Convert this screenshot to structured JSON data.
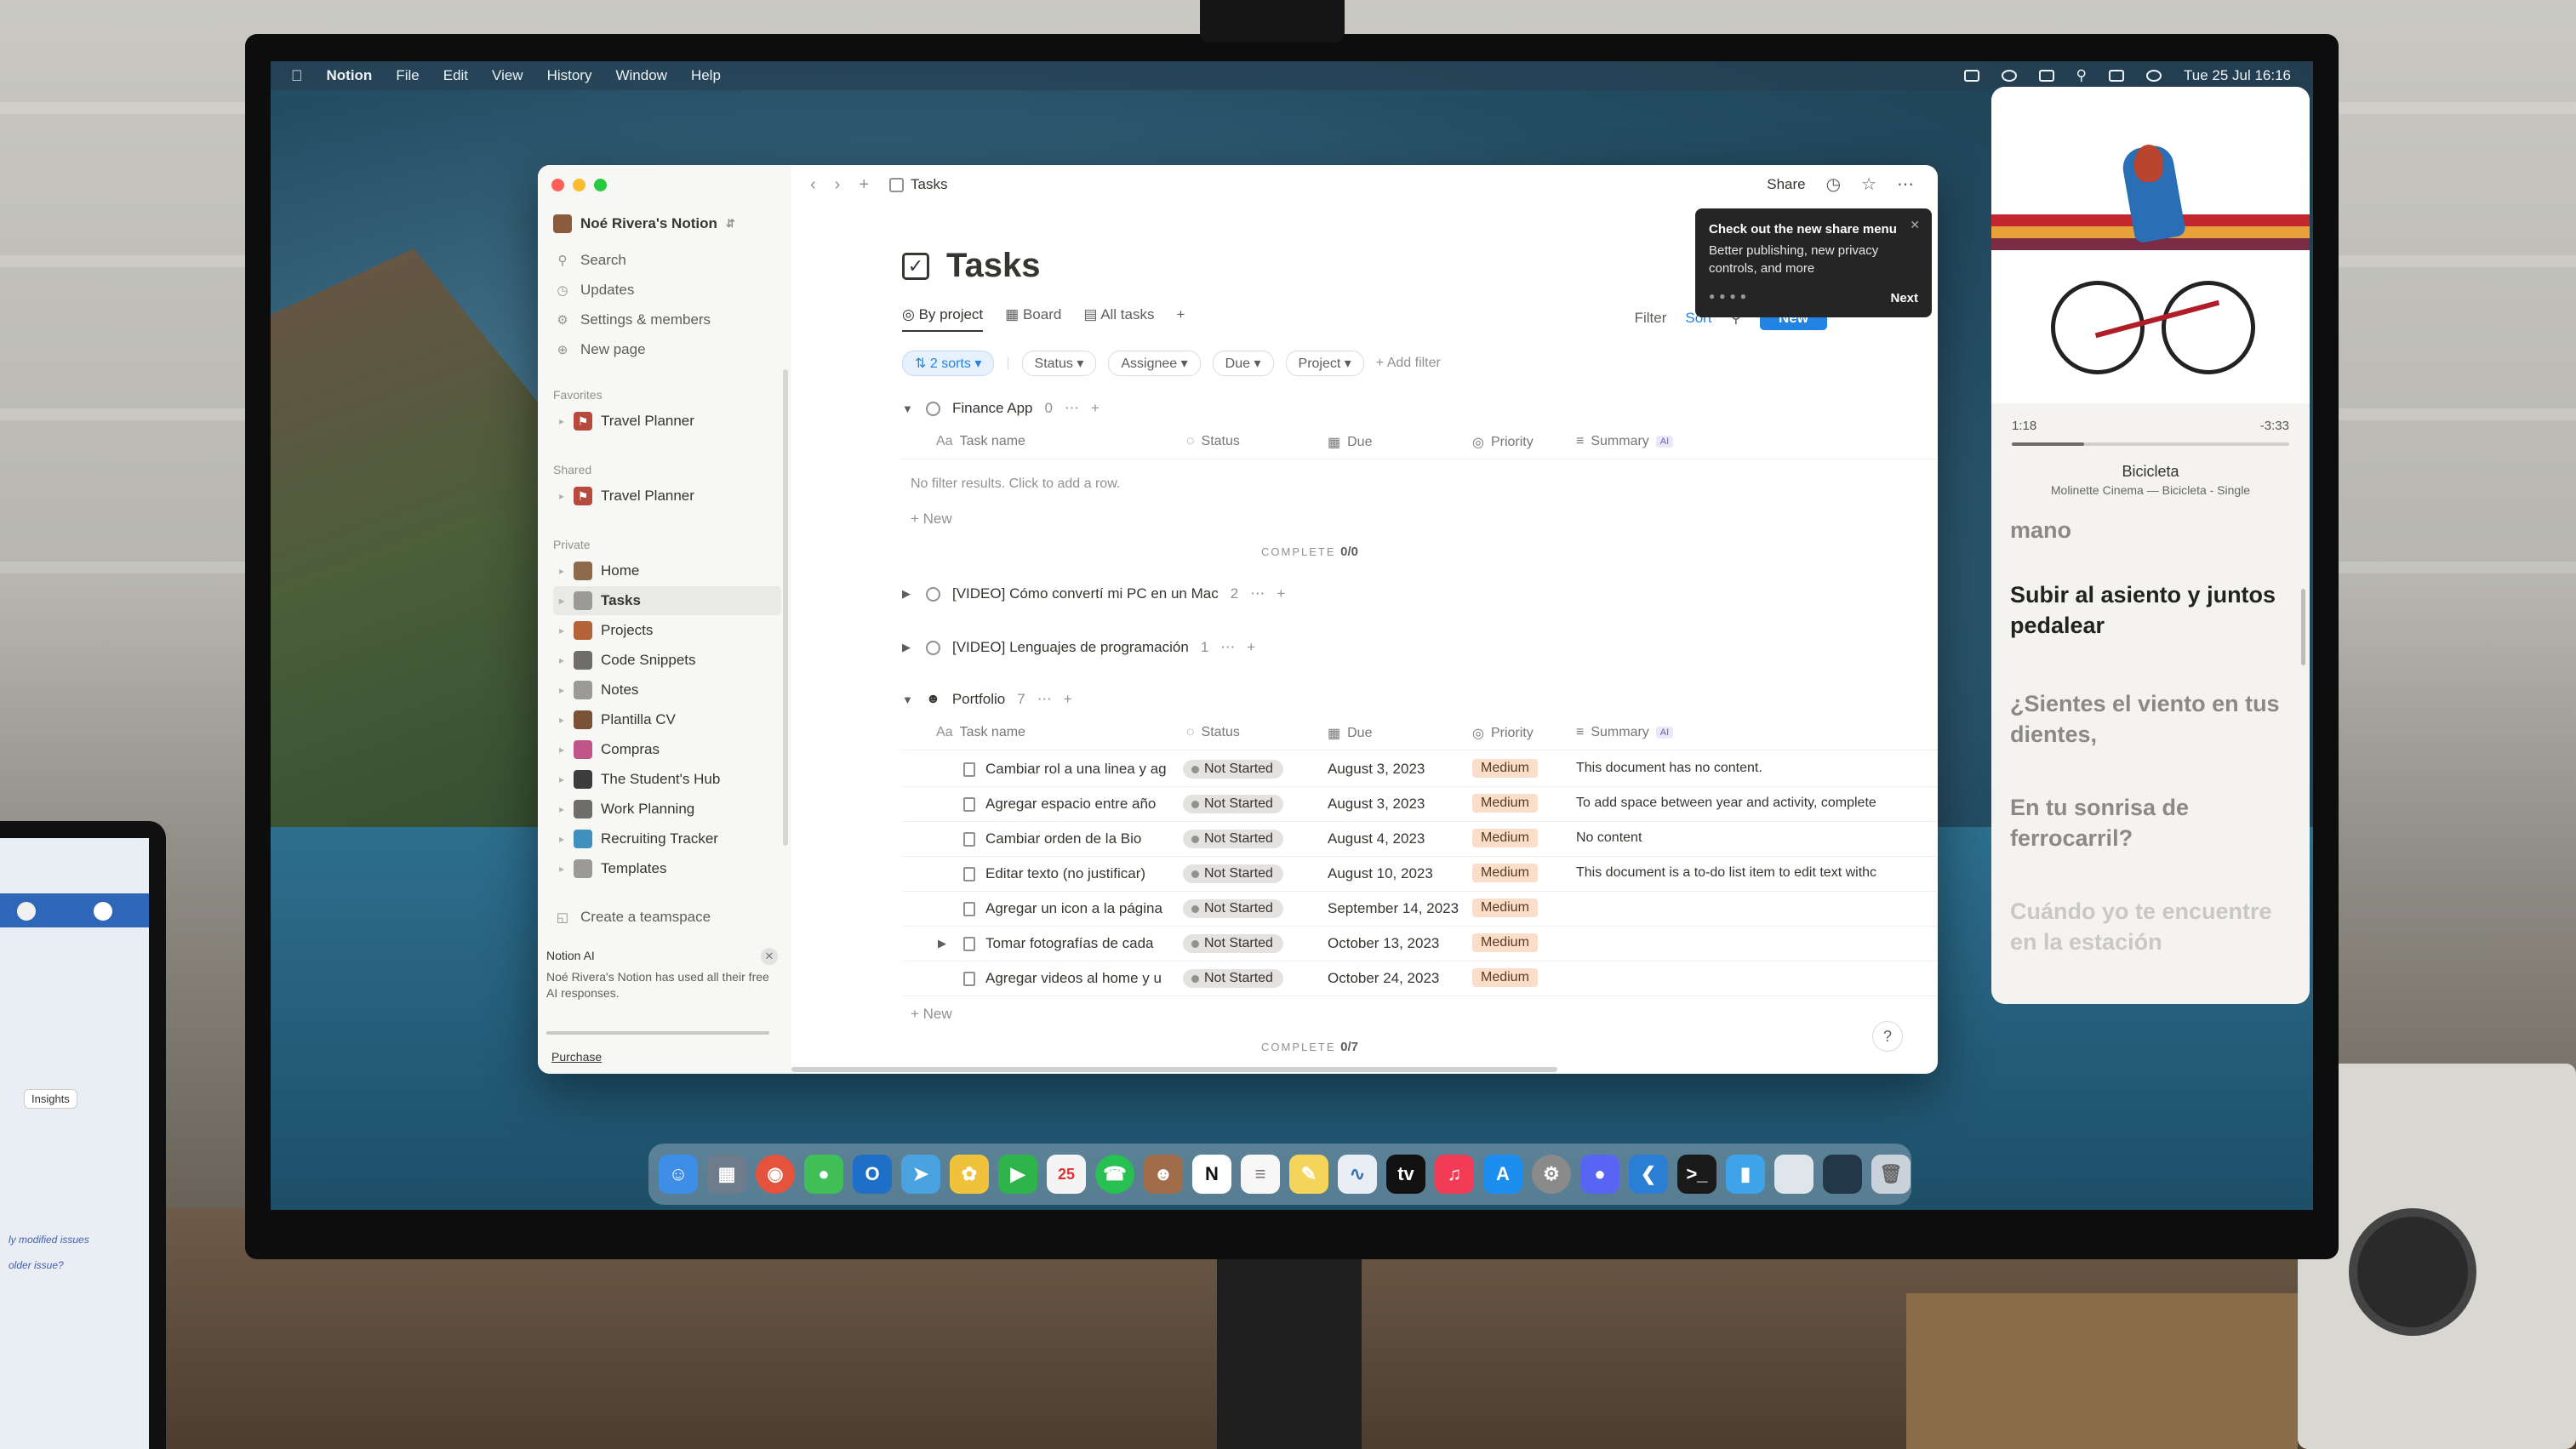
{
  "menubar": {
    "app": "Notion",
    "items": [
      "File",
      "Edit",
      "View",
      "History",
      "Window",
      "Help"
    ],
    "clock": "Tue 25 Jul  16:16"
  },
  "sidebar": {
    "workspace": "Noé Rivera's Notion",
    "top_items": [
      {
        "label": "Search",
        "icon": "search-icon"
      },
      {
        "label": "Updates",
        "icon": "clock-icon"
      },
      {
        "label": "Settings & members",
        "icon": "gear-icon"
      },
      {
        "label": "New page",
        "icon": "plus-circle-icon"
      }
    ],
    "favorites_label": "Favorites",
    "favorites": [
      "Travel Planner"
    ],
    "shared_label": "Shared",
    "shared": [
      "Travel Planner"
    ],
    "private_label": "Private",
    "private": [
      {
        "label": "Home",
        "color": "#8c6a4a"
      },
      {
        "label": "Tasks",
        "color": "#9b9a97"
      },
      {
        "label": "Projects",
        "color": "#b5643a"
      },
      {
        "label": "Code Snippets",
        "color": "#6e6d6a"
      },
      {
        "label": "Notes",
        "color": "#9b9a97"
      },
      {
        "label": "Plantilla CV",
        "color": "#7a5236"
      },
      {
        "label": "Compras",
        "color": "#c0558a"
      },
      {
        "label": "The Student's Hub",
        "color": "#3c3c3c"
      },
      {
        "label": "Work Planning",
        "color": "#6e6d6a"
      },
      {
        "label": "Recruiting Tracker",
        "color": "#3f8fbf"
      },
      {
        "label": "Templates",
        "color": "#9b9a97"
      }
    ],
    "create_teamspace": "Create a teamspace",
    "ai_title": "Notion AI",
    "ai_text": "Noé Rivera's Notion has used all their free AI responses.",
    "purchase": "Purchase"
  },
  "topbar": {
    "breadcrumb": "Tasks",
    "share": "Share"
  },
  "page": {
    "title": "Tasks",
    "views": [
      "By project",
      "Board",
      "All tasks"
    ],
    "filter": "Filter",
    "sort": "Sort",
    "new": "New",
    "sorts_chip": "2 sorts",
    "filter_chips": [
      "Status",
      "Assignee",
      "Due",
      "Project"
    ],
    "add_filter": "+ Add filter"
  },
  "tooltip": {
    "title": "Check out the new share menu",
    "text": "Better publishing, new privacy controls, and more",
    "next": "Next"
  },
  "columns": {
    "name": "Task name",
    "status": "Status",
    "due": "Due",
    "priority": "Priority",
    "summary": "Summary",
    "ai": "AI"
  },
  "groups": [
    {
      "name": "Finance App",
      "count": "0"
    },
    {
      "name": "[VIDEO] Cómo convertí mi PC en un Mac",
      "count": "2"
    },
    {
      "name": "[VIDEO] Lenguajes de programación",
      "count": "1"
    },
    {
      "name": "Portfolio",
      "count": "7"
    }
  ],
  "finance_empty": "No filter results. Click to add a row.",
  "new_row": "New",
  "complete_label": "COMPLETE",
  "complete_finance": "0/0",
  "complete_portfolio": "0/7",
  "tasks": [
    {
      "name": "Cambiar rol a una linea y ag",
      "status": "Not Started",
      "due": "August 3, 2023",
      "priority": "Medium",
      "summary": "This document has no content."
    },
    {
      "name": "Agregar espacio entre año",
      "status": "Not Started",
      "due": "August 3, 2023",
      "priority": "Medium",
      "summary": "To add space between year and activity, complete"
    },
    {
      "name": "Cambiar orden de la Bio",
      "status": "Not Started",
      "due": "August 4, 2023",
      "priority": "Medium",
      "summary": "No content"
    },
    {
      "name": "Editar texto (no justificar)",
      "status": "Not Started",
      "due": "August 10, 2023",
      "priority": "Medium",
      "summary": "This document is a to-do list item to edit text withc"
    },
    {
      "name": "Agregar un icon a la página",
      "status": "Not Started",
      "due": "September 14, 2023",
      "priority": "Medium",
      "summary": ""
    },
    {
      "name": "Tomar fotografías de cada",
      "status": "Not Started",
      "due": "October 13, 2023",
      "priority": "Medium",
      "summary": ""
    },
    {
      "name": "Agregar videos al home y u",
      "status": "Not Started",
      "due": "October 24, 2023",
      "priority": "Medium",
      "summary": ""
    }
  ],
  "help": "?",
  "music": {
    "elapsed": "1:18",
    "remaining": "-3:33",
    "progress": 0.26,
    "song": "Bicicleta",
    "artist": "Molinette Cinema — Bicicleta - Single",
    "lyrics": [
      "mano",
      "Subir al asiento y juntos pedalear",
      "¿Sientes el viento en tus dientes,",
      "En tu sonrisa de ferrocarril?",
      "Cuándo yo te encuentre en la estación"
    ]
  },
  "laptop": {
    "insights": "Insights",
    "text1": "ly modified issues",
    "text2": "older issue?"
  }
}
